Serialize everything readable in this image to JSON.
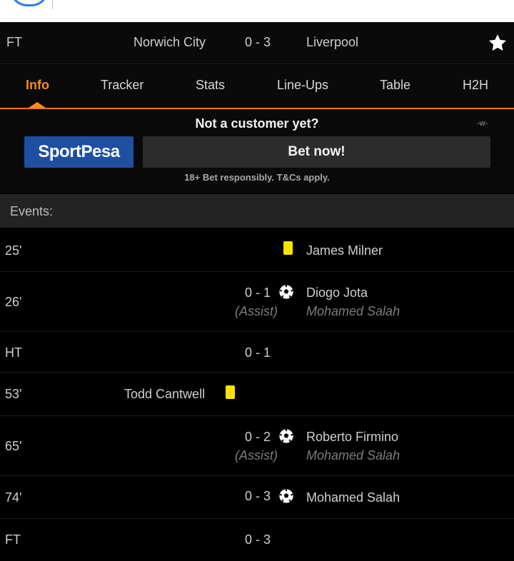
{
  "header": {
    "status": "FT",
    "home_team": "Norwich City",
    "score": "0 - 3",
    "away_team": "Liverpool",
    "favorite_icon": "star-icon"
  },
  "tabs": [
    {
      "label": "Info",
      "active": true
    },
    {
      "label": "Tracker"
    },
    {
      "label": "Stats"
    },
    {
      "label": "Line-Ups"
    },
    {
      "label": "Table"
    },
    {
      "label": "H2H"
    }
  ],
  "promo": {
    "title": "Not a customer yet?",
    "badge": "-w-",
    "brand": "SportPesa",
    "button_label": "Bet now!",
    "note": "18+ Bet responsibly. T&Cs apply.",
    "brand_color": "#1e4fa0"
  },
  "events": {
    "header": "Events:",
    "rows": [
      {
        "minute": "25'",
        "type": "yellow-card",
        "player": "James Milner"
      },
      {
        "minute": "26'",
        "type": "goal",
        "score": "0 - 1",
        "player": "Diogo Jota",
        "assist_label": "(Assist)",
        "assist": "Mohamed Salah"
      },
      {
        "minute": "HT",
        "type": "period",
        "score": "0 - 1"
      },
      {
        "minute": "53'",
        "type": "yellow-card",
        "player": "Todd Cantwell"
      },
      {
        "minute": "65'",
        "type": "goal",
        "score": "0 - 2",
        "player": "Roberto Firmino",
        "assist_label": "(Assist)",
        "assist": "Mohamed Salah"
      },
      {
        "minute": "74'",
        "type": "goal",
        "score": "0 - 3",
        "player": "Mohamed Salah"
      },
      {
        "minute": "FT",
        "type": "period",
        "score": "0 - 3"
      }
    ]
  },
  "colors": {
    "accent": "#ff8a1e",
    "yellow_card": "#ffe100",
    "background": "#000000"
  }
}
